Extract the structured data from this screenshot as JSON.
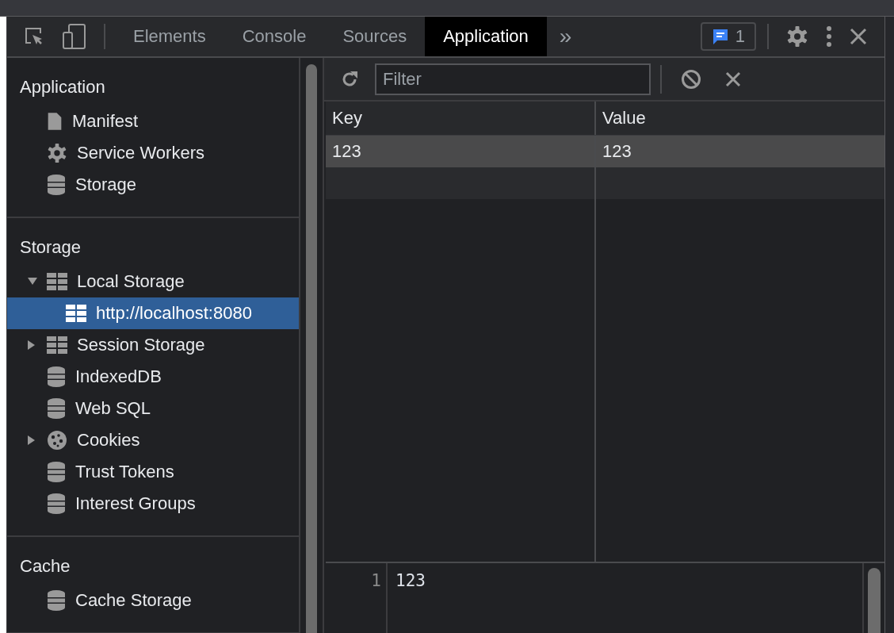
{
  "toolbar": {
    "tabs": [
      {
        "label": "Elements",
        "selected": false
      },
      {
        "label": "Console",
        "selected": false
      },
      {
        "label": "Sources",
        "selected": false
      },
      {
        "label": "Application",
        "selected": true
      }
    ],
    "more": "»",
    "issues_count": "1"
  },
  "sidebar": {
    "sections": [
      {
        "title": "Application",
        "items": [
          {
            "label": "Manifest",
            "kind": "file"
          },
          {
            "label": "Service Workers",
            "kind": "gear"
          },
          {
            "label": "Storage",
            "kind": "database"
          }
        ]
      },
      {
        "title": "Storage",
        "items": [
          {
            "label": "Local Storage",
            "kind": "grid",
            "expanded": true,
            "selected": false,
            "children": [
              {
                "label": "http://localhost:8080",
                "kind": "grid",
                "selected": true
              }
            ]
          },
          {
            "label": "Session Storage",
            "kind": "grid",
            "expanded": false,
            "selected": false
          },
          {
            "label": "IndexedDB",
            "kind": "database"
          },
          {
            "label": "Web SQL",
            "kind": "database"
          },
          {
            "label": "Cookies",
            "kind": "cookie",
            "expanded": false,
            "selected": false
          },
          {
            "label": "Trust Tokens",
            "kind": "database"
          },
          {
            "label": "Interest Groups",
            "kind": "database"
          }
        ]
      },
      {
        "title": "Cache",
        "items": [
          {
            "label": "Cache Storage",
            "kind": "database"
          }
        ]
      }
    ]
  },
  "storage_view": {
    "filter": {
      "placeholder": "Filter"
    },
    "table": {
      "columns": [
        "Key",
        "Value"
      ],
      "rows": [
        {
          "key": "123",
          "value": "123",
          "selected": true
        }
      ]
    },
    "preview": {
      "line_number": "1",
      "value": "123"
    }
  }
}
